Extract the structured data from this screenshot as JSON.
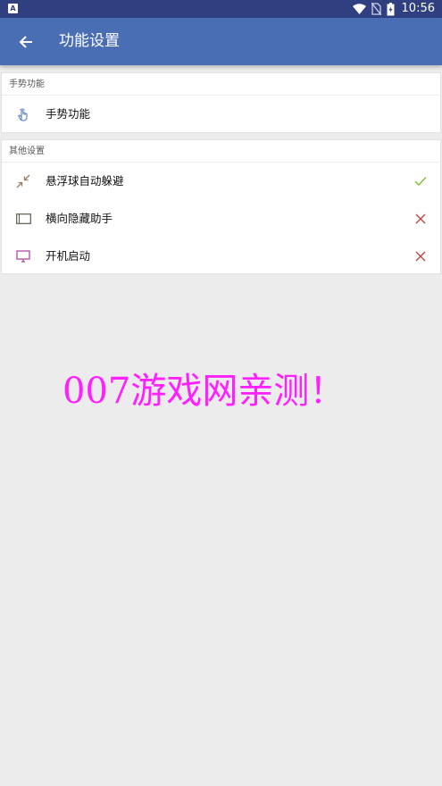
{
  "status_bar": {
    "app_icon_letter": "A",
    "time": "10:56",
    "icons": [
      "wifi-icon",
      "no-sim-icon",
      "battery-icon"
    ]
  },
  "app_bar": {
    "back_icon": "arrow-back-icon",
    "title": "功能设置",
    "color": "#4a6eb3"
  },
  "sections": [
    {
      "header": "手势功能",
      "items": [
        {
          "label": "手势功能",
          "icon": "hand-pointer-icon",
          "icon_color": "#5a7bbf"
        }
      ]
    },
    {
      "header": "其他设置",
      "items": [
        {
          "label": "悬浮球自动躲避",
          "icon": "collapse-arrows-icon",
          "icon_color": "#9a7e61",
          "state": "check",
          "state_color": "#7cbf2a"
        },
        {
          "label": "横向隐藏助手",
          "icon": "landscape-screen-icon",
          "icon_color": "#5e5e4e",
          "state": "cross",
          "state_color": "#c04040"
        },
        {
          "label": "开机启动",
          "icon": "monitor-icon",
          "icon_color": "#b04aa3",
          "state": "cross",
          "state_color": "#c04040"
        }
      ]
    }
  ],
  "watermark": {
    "text": "007游戏网亲测！",
    "color": "#ff1fff"
  }
}
